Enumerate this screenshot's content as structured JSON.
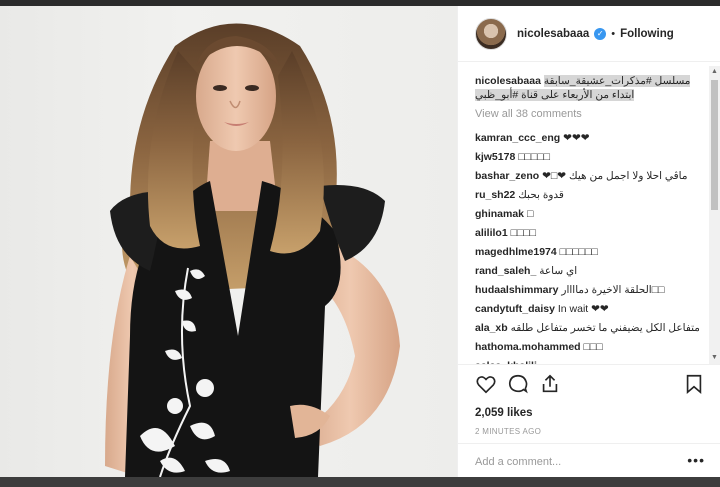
{
  "header": {
    "username": "nicolesabaaa",
    "separator": "•",
    "follow_label": "Following"
  },
  "caption": {
    "username": "nicolesabaaa",
    "text": "مسلسل #مذكرات_عشيقة_سابقة ابتداء من الأربعاء على قناة #أبو_ظبي"
  },
  "view_all": "View all 38 comments",
  "comments": [
    {
      "user": "kamran_ccc_eng",
      "text": "❤❤❤"
    },
    {
      "user": "kjw5178",
      "text": "□□□□□"
    },
    {
      "user": "bashar_zeno",
      "text": "❤□❤ ماڤي احلا ولا اجمل من هيك"
    },
    {
      "user": "ru_sh22",
      "text": "قدوة بحبك"
    },
    {
      "user": "ghinamak",
      "text": "□"
    },
    {
      "user": "alililo1",
      "text": "□□□□"
    },
    {
      "user": "magedhlme1974",
      "text": "□□□□□□"
    },
    {
      "user": "rand_saleh_",
      "text": "اي ساعة"
    },
    {
      "user": "hudaalshimmary",
      "text": "الحلقة الاخيرة دماااار□□"
    },
    {
      "user": "candytuft_daisy",
      "text": "In wait ❤❤"
    },
    {
      "user": "ala_xb",
      "text": "متفاعل الكل يضيفني ما تخسر متفاعل طلقه"
    },
    {
      "user": "hathoma.mohammed",
      "text": "□□□"
    },
    {
      "user": "aalaa_khalili",
      "text": "..."
    }
  ],
  "likes": "2,059 likes",
  "time": "2 MINUTES AGO",
  "add_comment_placeholder": "Add a comment...",
  "more_label": "•••",
  "scroll_up": "▲",
  "scroll_down": "▼",
  "icons": {
    "verified": "verified-badge-icon",
    "like": "heart-icon",
    "comment": "comment-icon",
    "share": "share-icon",
    "save": "bookmark-icon",
    "avatar": "profile-avatar",
    "photo": "post-photo"
  },
  "colors": {
    "link_blue": "#3897f0",
    "text": "#262626",
    "muted": "#999999"
  }
}
